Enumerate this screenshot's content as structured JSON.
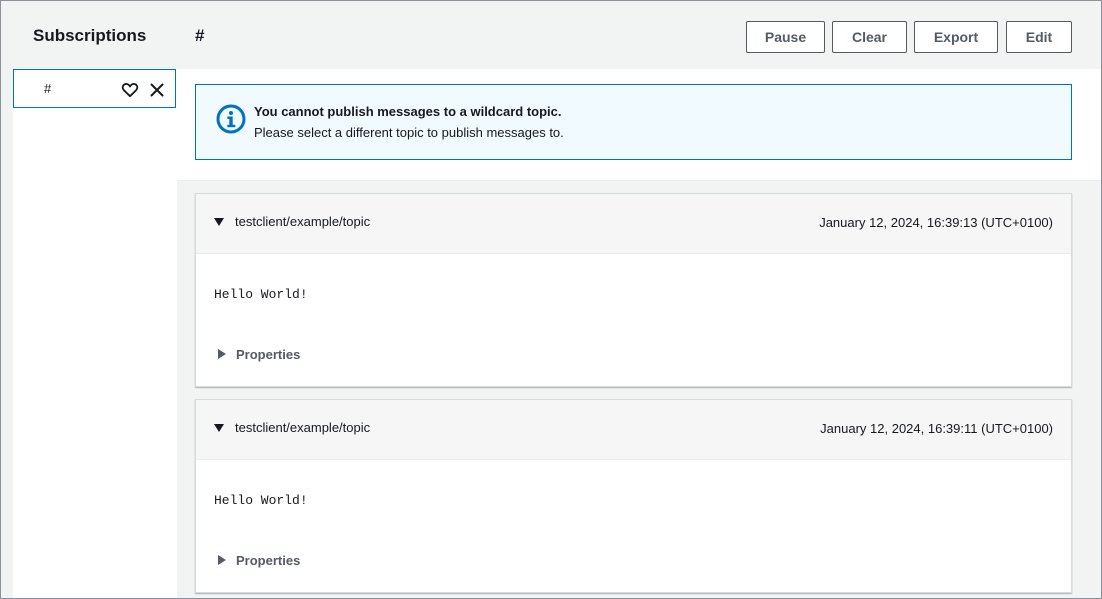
{
  "sidebar": {
    "title": "Subscriptions",
    "items": [
      {
        "label": "#"
      }
    ]
  },
  "header": {
    "topic": "#",
    "buttons": {
      "pause": "Pause",
      "clear": "Clear",
      "export": "Export",
      "edit": "Edit"
    }
  },
  "alert": {
    "icon": "info-icon",
    "title": "You cannot publish messages to a wildcard topic.",
    "body": "Please select a different topic to publish messages to."
  },
  "messages": [
    {
      "topic": "testclient/example/topic",
      "timestamp": "January 12, 2024, 16:39:13 (UTC+0100)",
      "payload": "Hello World!",
      "properties_label": "Properties"
    },
    {
      "topic": "testclient/example/topic",
      "timestamp": "January 12, 2024, 16:39:11 (UTC+0100)",
      "payload": "Hello World!",
      "properties_label": "Properties"
    }
  ],
  "colors": {
    "accent": "#0073bb",
    "alert_bg": "#f1faff",
    "panel_bg": "#f2f3f3"
  }
}
